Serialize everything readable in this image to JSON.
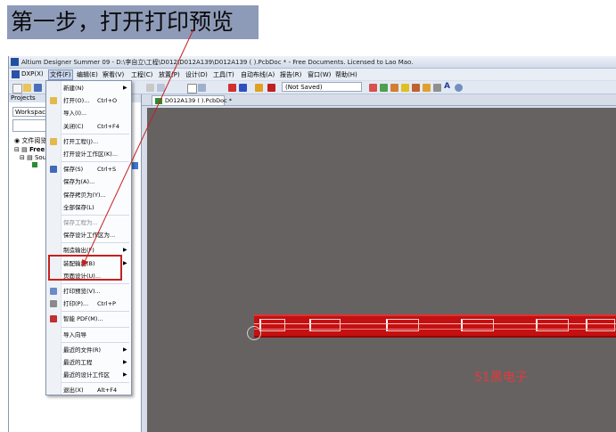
{
  "heading": "第一步，打开打印预览",
  "window": {
    "title": "Altium Designer Summer 09 - D:\\李自立\\工程\\D012\\D012A139\\D012A139 ( ).PcbDoc * - Free Documents. Licensed to Lao Mao."
  },
  "menubar": [
    "DXP(X)",
    "文件(F)",
    "编辑(E)",
    "察看(V)",
    "工程(C)",
    "放置(P)",
    "设计(D)",
    "工具(T)",
    "自动布线(A)",
    "报告(R)",
    "窗口(W)",
    "帮助(H)"
  ],
  "toolbar": {
    "combo_value": "(Not Saved)"
  },
  "panel": {
    "title": "Projects",
    "workspace_label": "Workspace1",
    "file_view": "文件阅览",
    "tree": [
      "Free",
      "Sou"
    ]
  },
  "document_tab": "D012A139 ( ).PcbDoc *",
  "watermark": "51黑电子",
  "file_menu": [
    {
      "label": "新建(N)",
      "shortcut": "",
      "arrow": true,
      "disabled": false,
      "icon": ""
    },
    {
      "label": "打开(O)...",
      "shortcut": "Ctrl+O",
      "arrow": false,
      "disabled": false,
      "icon": "open-folder-icon"
    },
    {
      "label": "导入(I)...",
      "shortcut": "",
      "arrow": false,
      "disabled": false,
      "icon": ""
    },
    {
      "label": "关闭(C)",
      "shortcut": "Ctrl+F4",
      "arrow": false,
      "disabled": false,
      "icon": ""
    },
    {
      "label": "打开工程(J)...",
      "shortcut": "",
      "arrow": false,
      "disabled": false,
      "icon": "open-project-icon"
    },
    {
      "label": "打开设计工作区(K)...",
      "shortcut": "",
      "arrow": false,
      "disabled": false,
      "icon": ""
    },
    {
      "label": "保存(S)",
      "shortcut": "Ctrl+S",
      "arrow": false,
      "disabled": false,
      "icon": "save-icon"
    },
    {
      "label": "保存为(A)...",
      "shortcut": "",
      "arrow": false,
      "disabled": false,
      "icon": ""
    },
    {
      "label": "保存拷贝为(Y)...",
      "shortcut": "",
      "arrow": false,
      "disabled": false,
      "icon": ""
    },
    {
      "label": "全部保存(L)",
      "shortcut": "",
      "arrow": false,
      "disabled": false,
      "icon": ""
    },
    {
      "label": "保存工程为...",
      "shortcut": "",
      "arrow": false,
      "disabled": true,
      "icon": ""
    },
    {
      "label": "保存设计工作区为...",
      "shortcut": "",
      "arrow": false,
      "disabled": false,
      "icon": ""
    },
    {
      "label": "制造输出(F)",
      "shortcut": "",
      "arrow": true,
      "disabled": false,
      "icon": ""
    },
    {
      "label": "装配输出(B)",
      "shortcut": "",
      "arrow": true,
      "disabled": false,
      "icon": ""
    },
    {
      "label": "页面设计(U)...",
      "shortcut": "",
      "arrow": false,
      "disabled": false,
      "icon": ""
    },
    {
      "label": "打印预览(V)...",
      "shortcut": "",
      "arrow": false,
      "disabled": false,
      "icon": "print-preview-icon"
    },
    {
      "label": "打印(P)...",
      "shortcut": "Ctrl+P",
      "arrow": false,
      "disabled": false,
      "icon": "print-icon"
    },
    {
      "label": "智能 PDF(M)...",
      "shortcut": "",
      "arrow": false,
      "disabled": false,
      "icon": "pdf-icon"
    },
    {
      "label": "导入向导",
      "shortcut": "",
      "arrow": false,
      "disabled": false,
      "icon": ""
    },
    {
      "label": "最近的文件(R)",
      "shortcut": "",
      "arrow": true,
      "disabled": false,
      "icon": ""
    },
    {
      "label": "最近的工程",
      "shortcut": "",
      "arrow": true,
      "disabled": false,
      "icon": ""
    },
    {
      "label": "最近的设计工作区",
      "shortcut": "",
      "arrow": true,
      "disabled": false,
      "icon": ""
    },
    {
      "label": "退出(X)",
      "shortcut": "Alt+F4",
      "arrow": false,
      "disabled": false,
      "icon": ""
    }
  ],
  "colors": {
    "heading_bg": "#8e9bb8",
    "canvas": "#666262",
    "board": "#c41010",
    "annotation": "#c62020"
  }
}
